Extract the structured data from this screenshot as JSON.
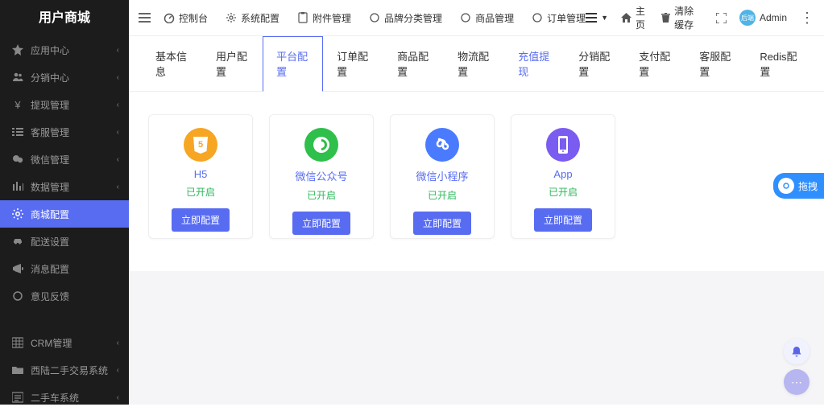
{
  "brand": "用户商城",
  "sidebar": {
    "items": [
      {
        "label": "应用中心",
        "icon": "star"
      },
      {
        "label": "分销中心",
        "icon": "users"
      },
      {
        "label": "提现管理",
        "icon": "yen"
      },
      {
        "label": "客服管理",
        "icon": "list"
      },
      {
        "label": "微信管理",
        "icon": "wechat"
      },
      {
        "label": "数据管理",
        "icon": "bars"
      },
      {
        "label": "商城配置",
        "icon": "cogs",
        "active": true
      },
      {
        "label": "配送设置",
        "icon": "car"
      },
      {
        "label": "消息配置",
        "icon": "bullhorn"
      },
      {
        "label": "意见反馈",
        "icon": "circle"
      },
      {
        "label": "CRM管理",
        "icon": "grid"
      },
      {
        "label": "西陆二手交易系统",
        "icon": "folder"
      },
      {
        "label": "二手车系统",
        "icon": "list2"
      }
    ]
  },
  "topnav": {
    "items": [
      {
        "label": "控制台",
        "icon": "dashboard"
      },
      {
        "label": "系统配置",
        "icon": "gear"
      },
      {
        "label": "附件管理",
        "icon": "clip"
      },
      {
        "label": "品牌分类管理",
        "icon": "circleo"
      },
      {
        "label": "商品管理",
        "icon": "circleo"
      },
      {
        "label": "订单管理",
        "icon": "circleo"
      }
    ],
    "home": "主页",
    "clear": "清除缓存",
    "user": "Admin"
  },
  "tabs": [
    "基本信息",
    "用户配置",
    "平台配置",
    "订单配置",
    "商品配置",
    "物流配置",
    "充值提现",
    "分销配置",
    "支付配置",
    "客服配置",
    "Redis配置"
  ],
  "tabs_active_index": 2,
  "tabs_highlight_index": 6,
  "cards": [
    {
      "title": "H5",
      "status": "已开启",
      "btn": "立即配置",
      "color": "#f6a623",
      "icon": "h5"
    },
    {
      "title": "微信公众号",
      "status": "已开启",
      "btn": "立即配置",
      "color": "#2fbf4b",
      "icon": "wechat"
    },
    {
      "title": "微信小程序",
      "status": "已开启",
      "btn": "立即配置",
      "color": "#4a7bff",
      "icon": "mini"
    },
    {
      "title": "App",
      "status": "已开启",
      "btn": "立即配置",
      "color": "#7a5cf0",
      "icon": "app"
    }
  ],
  "float_tag": "拖拽",
  "avatar_text": "后端"
}
